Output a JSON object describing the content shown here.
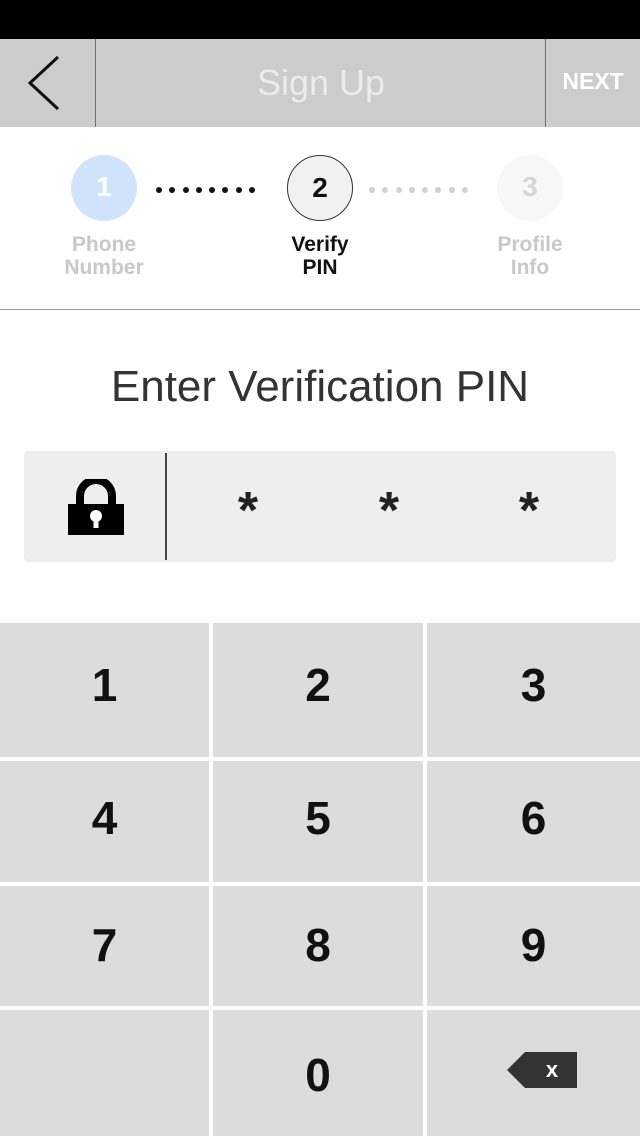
{
  "nav": {
    "title": "Sign Up",
    "next_label": "NEXT",
    "back_icon": "chevron-left-icon"
  },
  "stepper": {
    "steps": [
      {
        "number": "1",
        "label_line1": "Phone",
        "label_line2": "Number",
        "state": "completed"
      },
      {
        "number": "2",
        "label_line1": "Verify",
        "label_line2": "PIN",
        "state": "active"
      },
      {
        "number": "3",
        "label_line1": "Profile",
        "label_line2": "Info",
        "state": "upcoming"
      }
    ]
  },
  "heading": "Enter Verification PIN",
  "pin": {
    "icon": "lock-icon",
    "digits": [
      "*",
      "*",
      "*"
    ]
  },
  "keypad": {
    "keys": [
      "1",
      "2",
      "3",
      "4",
      "5",
      "6",
      "7",
      "8",
      "9",
      "",
      "0"
    ],
    "backspace_icon": "backspace-icon",
    "backspace_glyph": "x"
  },
  "colors": {
    "status_bar": "#000000",
    "nav_bar": "#cccccc",
    "step_completed": "#cfe4fb",
    "key_background": "#dcdcdc",
    "pin_background": "#eeeeee"
  }
}
